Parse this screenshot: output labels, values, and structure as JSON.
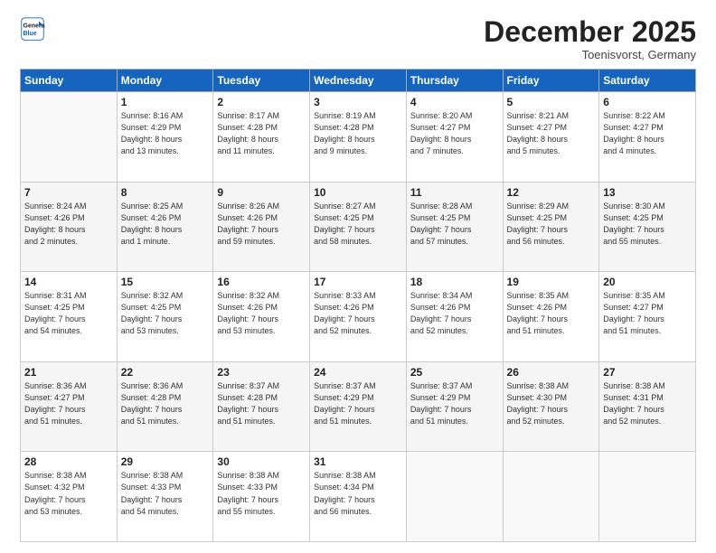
{
  "logo": {
    "line1": "General",
    "line2": "Blue"
  },
  "header": {
    "month": "December 2025",
    "location": "Toenisvorst, Germany"
  },
  "weekdays": [
    "Sunday",
    "Monday",
    "Tuesday",
    "Wednesday",
    "Thursday",
    "Friday",
    "Saturday"
  ],
  "weeks": [
    [
      {
        "day": "",
        "info": ""
      },
      {
        "day": "1",
        "info": "Sunrise: 8:16 AM\nSunset: 4:29 PM\nDaylight: 8 hours\nand 13 minutes."
      },
      {
        "day": "2",
        "info": "Sunrise: 8:17 AM\nSunset: 4:28 PM\nDaylight: 8 hours\nand 11 minutes."
      },
      {
        "day": "3",
        "info": "Sunrise: 8:19 AM\nSunset: 4:28 PM\nDaylight: 8 hours\nand 9 minutes."
      },
      {
        "day": "4",
        "info": "Sunrise: 8:20 AM\nSunset: 4:27 PM\nDaylight: 8 hours\nand 7 minutes."
      },
      {
        "day": "5",
        "info": "Sunrise: 8:21 AM\nSunset: 4:27 PM\nDaylight: 8 hours\nand 5 minutes."
      },
      {
        "day": "6",
        "info": "Sunrise: 8:22 AM\nSunset: 4:27 PM\nDaylight: 8 hours\nand 4 minutes."
      }
    ],
    [
      {
        "day": "7",
        "info": "Sunrise: 8:24 AM\nSunset: 4:26 PM\nDaylight: 8 hours\nand 2 minutes."
      },
      {
        "day": "8",
        "info": "Sunrise: 8:25 AM\nSunset: 4:26 PM\nDaylight: 8 hours\nand 1 minute."
      },
      {
        "day": "9",
        "info": "Sunrise: 8:26 AM\nSunset: 4:26 PM\nDaylight: 7 hours\nand 59 minutes."
      },
      {
        "day": "10",
        "info": "Sunrise: 8:27 AM\nSunset: 4:25 PM\nDaylight: 7 hours\nand 58 minutes."
      },
      {
        "day": "11",
        "info": "Sunrise: 8:28 AM\nSunset: 4:25 PM\nDaylight: 7 hours\nand 57 minutes."
      },
      {
        "day": "12",
        "info": "Sunrise: 8:29 AM\nSunset: 4:25 PM\nDaylight: 7 hours\nand 56 minutes."
      },
      {
        "day": "13",
        "info": "Sunrise: 8:30 AM\nSunset: 4:25 PM\nDaylight: 7 hours\nand 55 minutes."
      }
    ],
    [
      {
        "day": "14",
        "info": "Sunrise: 8:31 AM\nSunset: 4:25 PM\nDaylight: 7 hours\nand 54 minutes."
      },
      {
        "day": "15",
        "info": "Sunrise: 8:32 AM\nSunset: 4:25 PM\nDaylight: 7 hours\nand 53 minutes."
      },
      {
        "day": "16",
        "info": "Sunrise: 8:32 AM\nSunset: 4:26 PM\nDaylight: 7 hours\nand 53 minutes."
      },
      {
        "day": "17",
        "info": "Sunrise: 8:33 AM\nSunset: 4:26 PM\nDaylight: 7 hours\nand 52 minutes."
      },
      {
        "day": "18",
        "info": "Sunrise: 8:34 AM\nSunset: 4:26 PM\nDaylight: 7 hours\nand 52 minutes."
      },
      {
        "day": "19",
        "info": "Sunrise: 8:35 AM\nSunset: 4:26 PM\nDaylight: 7 hours\nand 51 minutes."
      },
      {
        "day": "20",
        "info": "Sunrise: 8:35 AM\nSunset: 4:27 PM\nDaylight: 7 hours\nand 51 minutes."
      }
    ],
    [
      {
        "day": "21",
        "info": "Sunrise: 8:36 AM\nSunset: 4:27 PM\nDaylight: 7 hours\nand 51 minutes."
      },
      {
        "day": "22",
        "info": "Sunrise: 8:36 AM\nSunset: 4:28 PM\nDaylight: 7 hours\nand 51 minutes."
      },
      {
        "day": "23",
        "info": "Sunrise: 8:37 AM\nSunset: 4:28 PM\nDaylight: 7 hours\nand 51 minutes."
      },
      {
        "day": "24",
        "info": "Sunrise: 8:37 AM\nSunset: 4:29 PM\nDaylight: 7 hours\nand 51 minutes."
      },
      {
        "day": "25",
        "info": "Sunrise: 8:37 AM\nSunset: 4:29 PM\nDaylight: 7 hours\nand 51 minutes."
      },
      {
        "day": "26",
        "info": "Sunrise: 8:38 AM\nSunset: 4:30 PM\nDaylight: 7 hours\nand 52 minutes."
      },
      {
        "day": "27",
        "info": "Sunrise: 8:38 AM\nSunset: 4:31 PM\nDaylight: 7 hours\nand 52 minutes."
      }
    ],
    [
      {
        "day": "28",
        "info": "Sunrise: 8:38 AM\nSunset: 4:32 PM\nDaylight: 7 hours\nand 53 minutes."
      },
      {
        "day": "29",
        "info": "Sunrise: 8:38 AM\nSunset: 4:33 PM\nDaylight: 7 hours\nand 54 minutes."
      },
      {
        "day": "30",
        "info": "Sunrise: 8:38 AM\nSunset: 4:33 PM\nDaylight: 7 hours\nand 55 minutes."
      },
      {
        "day": "31",
        "info": "Sunrise: 8:38 AM\nSunset: 4:34 PM\nDaylight: 7 hours\nand 56 minutes."
      },
      {
        "day": "",
        "info": ""
      },
      {
        "day": "",
        "info": ""
      },
      {
        "day": "",
        "info": ""
      }
    ]
  ]
}
